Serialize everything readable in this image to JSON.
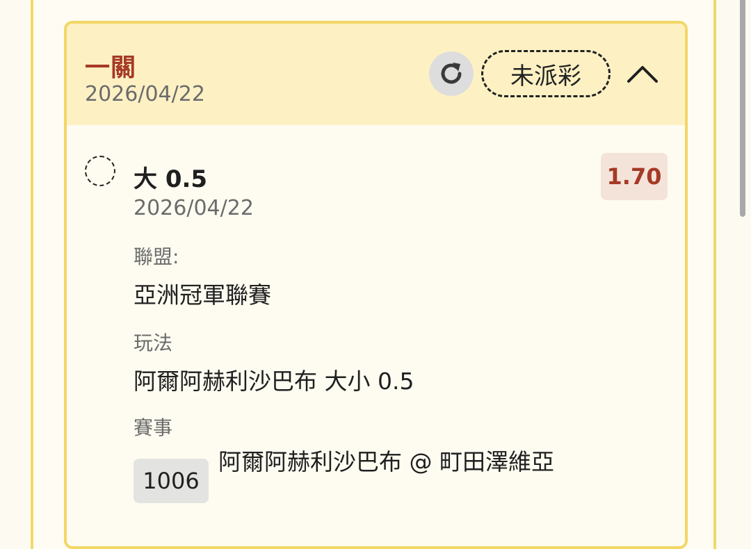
{
  "card": {
    "title": "一關",
    "date": "2026/04/22",
    "status": "未派彩",
    "icons": {
      "refresh": "refresh-icon",
      "collapse": "chevron-up-icon"
    }
  },
  "bet": {
    "selection": "大 0.5",
    "date": "2026/04/22",
    "odds": "1.70",
    "league_label": "聯盟:",
    "league_value": "亞洲冠軍聯賽",
    "play_label": "玩法",
    "play_value": "阿爾阿赫利沙巴布 大小 0.5",
    "match_label": "賽事",
    "match_id": "1006",
    "match_name": "阿爾阿赫利沙巴布 @ 町田澤維亞"
  },
  "colors": {
    "accent_red": "#a53a26",
    "card_border": "#f2d766",
    "header_bg": "#fdf1c4",
    "odds_bg": "#f4e3d9"
  }
}
